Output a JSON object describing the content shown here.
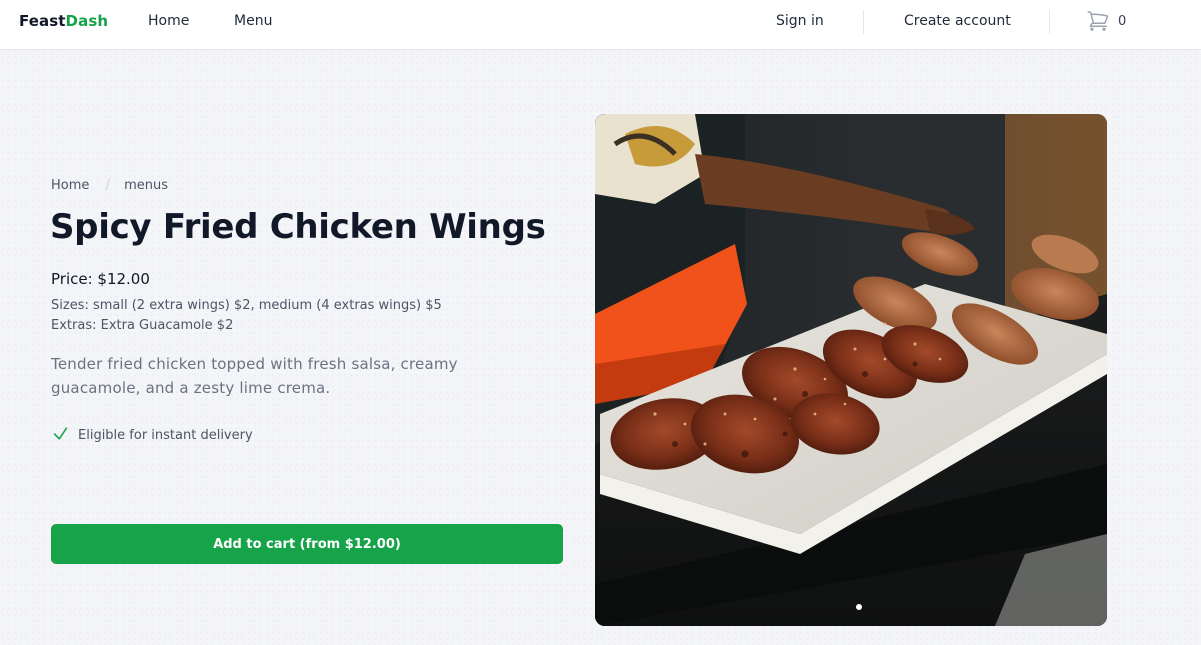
{
  "nav": {
    "brand_part1": "Feast",
    "brand_part2": "Dash",
    "links": [
      {
        "label": "Home"
      },
      {
        "label": "Menu"
      }
    ],
    "sign_in": "Sign in",
    "create_account": "Create account",
    "cart_icon": "cart-icon",
    "cart_count": "0"
  },
  "breadcrumb": {
    "items": [
      {
        "label": "Home"
      },
      {
        "label": "menus"
      }
    ],
    "separator": "/"
  },
  "product": {
    "title": "Spicy Fried Chicken Wings",
    "price": "Price: $12.00",
    "sizes": "Sizes: small (2 extra wings) $2, medium (4 extras wings) $5",
    "extras": "Extras: Extra Guacamole $2",
    "description": "Tender fried chicken topped with fresh salsa, creamy guacamole, and a zesty lime crema.",
    "delivery_label": "Eligible for instant delivery",
    "delivery_icon": "check-icon",
    "add_to_cart": "Add to cart (from $12.00)",
    "image_alt": "Plate of spicy fried chicken wings",
    "carousel_count": 1,
    "carousel_active": 1
  },
  "colors": {
    "brand": "#16a34a",
    "text": "#111827",
    "muted": "#6b7280",
    "background": "#f4f5f8"
  }
}
